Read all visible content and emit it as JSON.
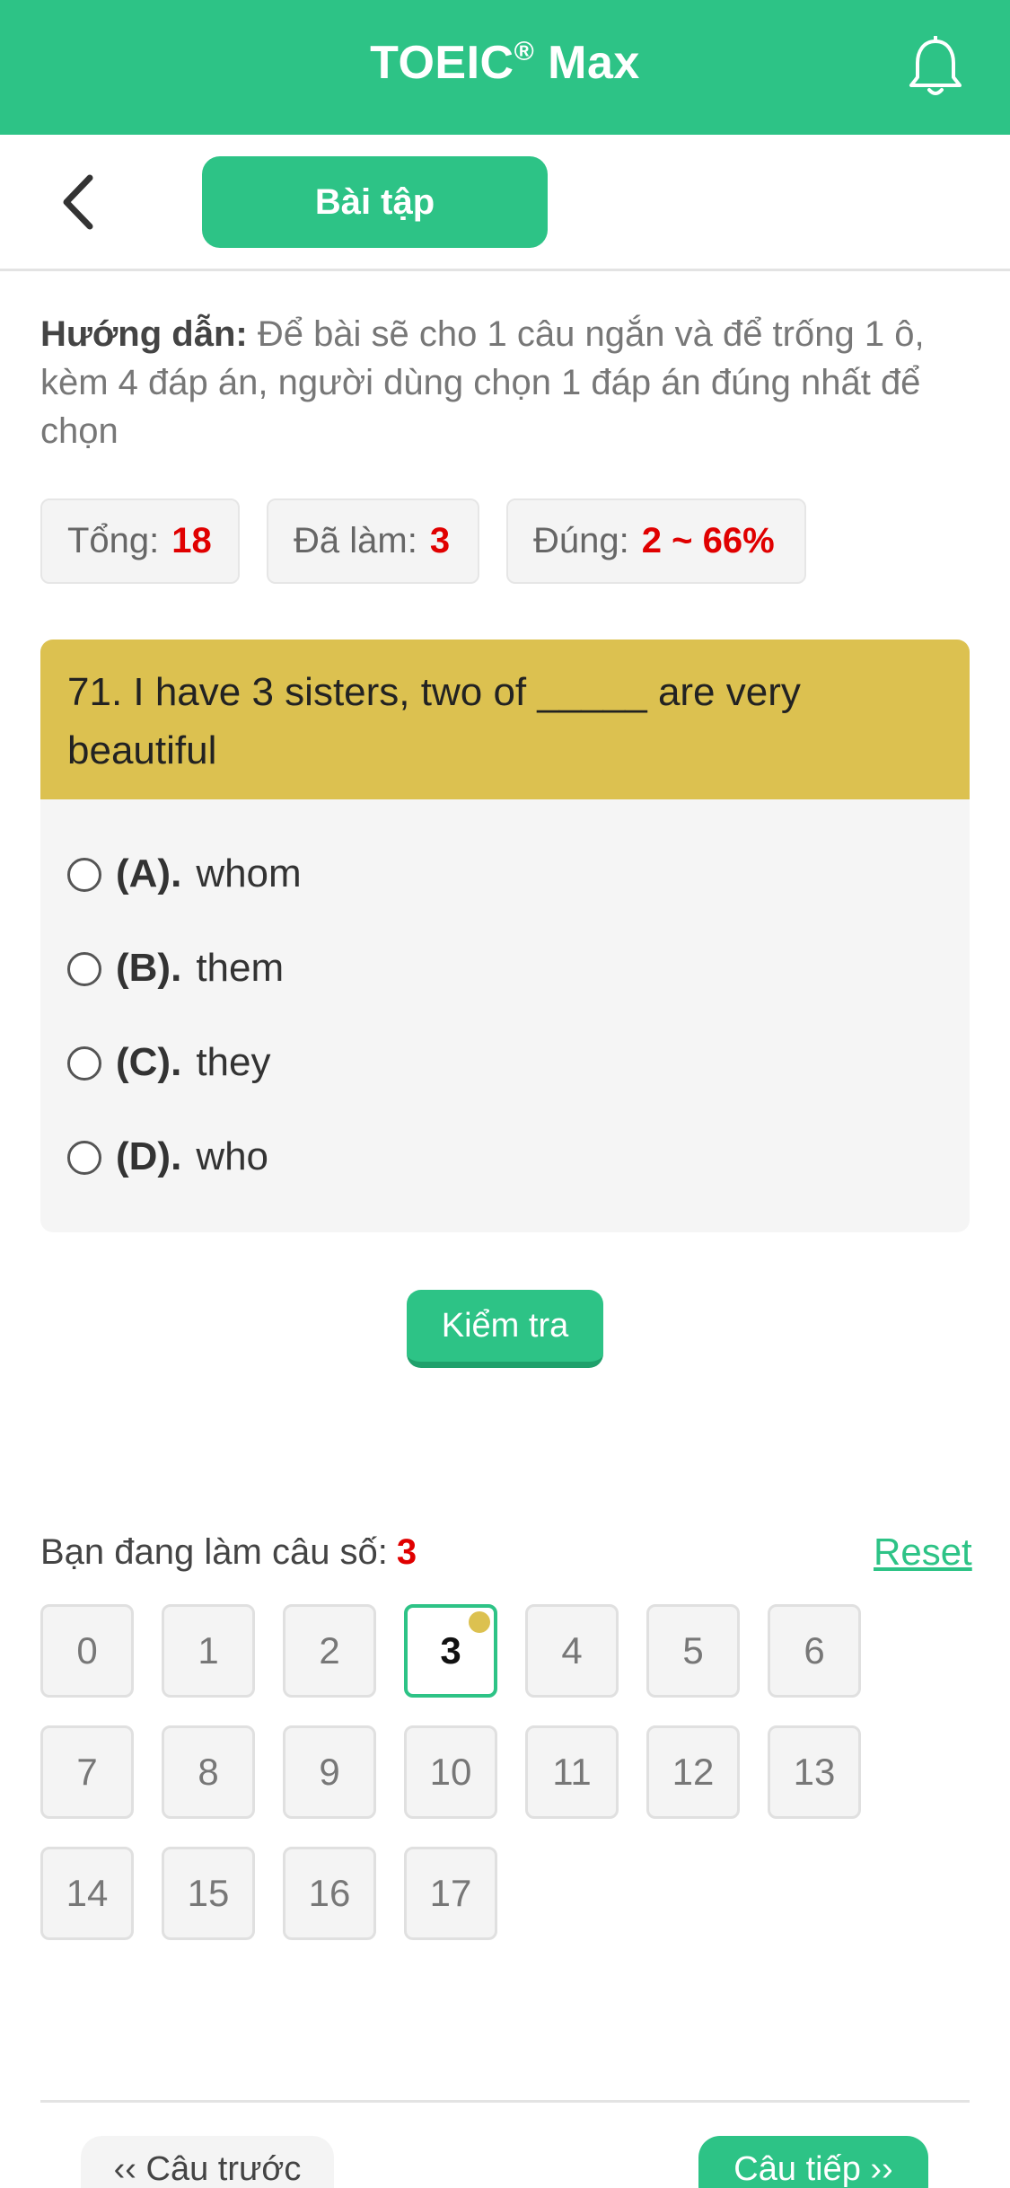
{
  "header": {
    "title": "TOEIC",
    "title_mark": "®",
    "title_suffix": " Max",
    "bell_icon": "bell-icon"
  },
  "subbar": {
    "back_icon": "chevron-left-icon",
    "tab_label": "Bài tập"
  },
  "guide": {
    "label": "Hướng dẫn:",
    "text": " Để bài sẽ cho 1 câu ngắn và để trống 1 ô, kèm 4 đáp án, người dùng chọn 1 đáp án đúng nhất để chọn"
  },
  "stats": [
    {
      "label": "Tổng:",
      "value": "18"
    },
    {
      "label": "Đã làm:",
      "value": "3"
    },
    {
      "label": "Đúng:",
      "value": "2 ~ 66%"
    }
  ],
  "question": {
    "text": "71. I have 3 sisters, two of _____ are very beautiful",
    "options": [
      {
        "key": "(A).",
        "text": "whom"
      },
      {
        "key": "(B).",
        "text": "them"
      },
      {
        "key": "(C).",
        "text": "they"
      },
      {
        "key": "(D).",
        "text": "who"
      }
    ]
  },
  "check_button": "Kiểm tra",
  "progress": {
    "label": "Bạn đang làm câu số:",
    "current": "3",
    "reset": "Reset"
  },
  "numbers": [
    "0",
    "1",
    "2",
    "3",
    "4",
    "5",
    "6",
    "7",
    "8",
    "9",
    "10",
    "11",
    "12",
    "13",
    "14",
    "15",
    "16",
    "17"
  ],
  "active_index": 3,
  "footer": {
    "prev": "‹‹ Câu trước",
    "next": "Câu tiếp ››"
  },
  "colors": {
    "primary": "#2dc386",
    "question_header": "#dcc150",
    "highlight": "#e00000"
  }
}
